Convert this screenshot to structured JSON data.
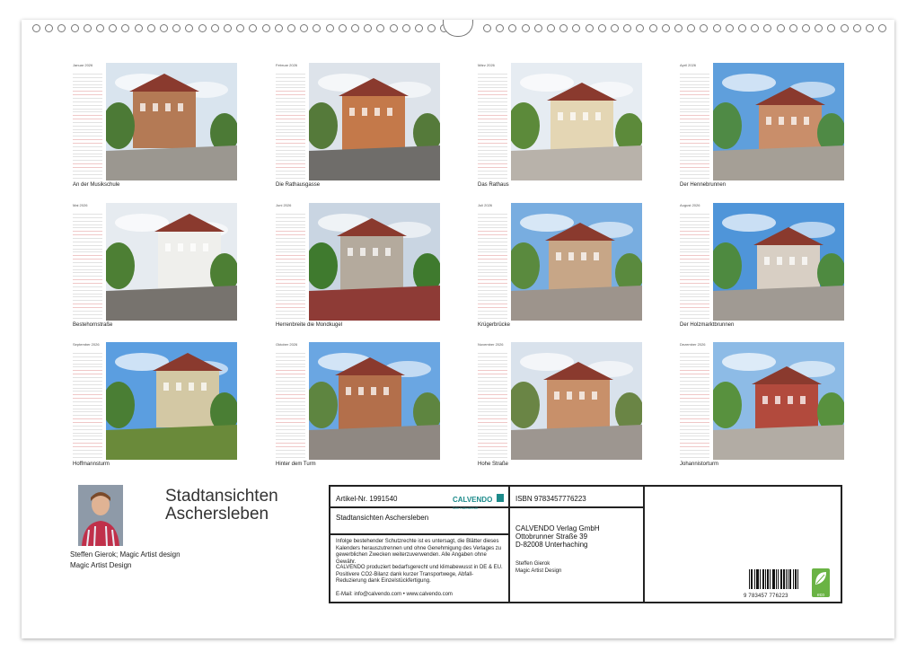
{
  "months": [
    {
      "name": "Januar 2026",
      "caption": "An der Musikschule",
      "sky": "#d9e4ee",
      "ground": "#9b9790",
      "build": "#b47a55",
      "tree": "#4c7a36"
    },
    {
      "name": "Februar 2026",
      "caption": "Die Rathausgasse",
      "sky": "#dde3ea",
      "ground": "#6f6d6a",
      "build": "#c4794a",
      "tree": "#557a3a"
    },
    {
      "name": "März 2026",
      "caption": "Das Rathaus",
      "sky": "#e6ecf2",
      "ground": "#b8b2aa",
      "build": "#e4d6b4",
      "tree": "#5c8a3a"
    },
    {
      "name": "April 2026",
      "caption": "Der Hennebrunnen",
      "sky": "#5f9fdc",
      "ground": "#a59f96",
      "build": "#c98e6a",
      "tree": "#4f8a45"
    },
    {
      "name": "Mai 2026",
      "caption": "Bestehornstraße",
      "sky": "#e6ebf0",
      "ground": "#77736e",
      "build": "#efefec",
      "tree": "#4d7f34"
    },
    {
      "name": "Juni 2026",
      "caption": "Herrenbreite die Mondkugel",
      "sky": "#c9d5e2",
      "ground": "#8e3b36",
      "build": "#b4aa9d",
      "tree": "#3f7a2e"
    },
    {
      "name": "Juli 2026",
      "caption": "Krügerbrücke",
      "sky": "#78ade0",
      "ground": "#9d948c",
      "build": "#c7a687",
      "tree": "#5a8a3e"
    },
    {
      "name": "August 2026",
      "caption": "Der Holzmarktbrunnen",
      "sky": "#4f95d9",
      "ground": "#a09a93",
      "build": "#d8cfc4",
      "tree": "#4e8a40"
    },
    {
      "name": "September 2026",
      "caption": "Hoffmannsturm",
      "sky": "#5b9ee0",
      "ground": "#6a8a3a",
      "build": "#d3c8a4",
      "tree": "#4a7e34"
    },
    {
      "name": "Oktober 2026",
      "caption": "Hinter dem Turm",
      "sky": "#6aa6e2",
      "ground": "#8f8882",
      "build": "#b36f4b",
      "tree": "#5e8540"
    },
    {
      "name": "November 2026",
      "caption": "Hohe Straße",
      "sky": "#d9e2ec",
      "ground": "#9d9690",
      "build": "#c8906a",
      "tree": "#6a8545"
    },
    {
      "name": "Dezember 2026",
      "caption": "Johannistorturm",
      "sky": "#8dbbe6",
      "ground": "#b2aca4",
      "build": "#b24a3d",
      "tree": "#58913e"
    }
  ],
  "title": {
    "line1": "Stadtansichten",
    "line2": "Aschersleben"
  },
  "author": {
    "line1": "Steffen Gierok; Magic Artist design",
    "line2": "Magic Artist Design"
  },
  "info": {
    "artikel": "Artikel-Nr. 1991540",
    "logo": "CALVENDO",
    "logo_sub": "Sehr Kalenderhaft",
    "product_title": "Stadtansichten Aschersleben",
    "rights": "Infolge bestehender Schutzrechte ist es untersagt, die Blätter dieses Kalenders herauszutrennen und ohne Genehmigung des Verlages zu gewerblichen Zwecken weiterzuverwenden. Alle Angaben ohne Gewähr.",
    "climate": "CALVENDO produziert bedarfsgerecht und klimabewusst in DE & EU. Positivere CO2-Bilanz dank kurzer Transportwege, Abfall-Reduzierung dank Einzelstückfertigung.",
    "contact": "E-Mail: info@calvendo.com • www.calvendo.com",
    "isbn": "ISBN 9783457776223",
    "publisher1": "CALVENDO Verlag GmbH",
    "publisher2": "Ottobrunner Straße 39",
    "publisher3": "D-82008 Unterhaching",
    "credit1": "Steffen Gierok",
    "credit2": "Magic Artist Design",
    "barcode_digits": "9 783457 776223",
    "eco_label": "eco"
  },
  "colors": {
    "brand": "#1c8a8a",
    "eco": "#6ab344"
  }
}
